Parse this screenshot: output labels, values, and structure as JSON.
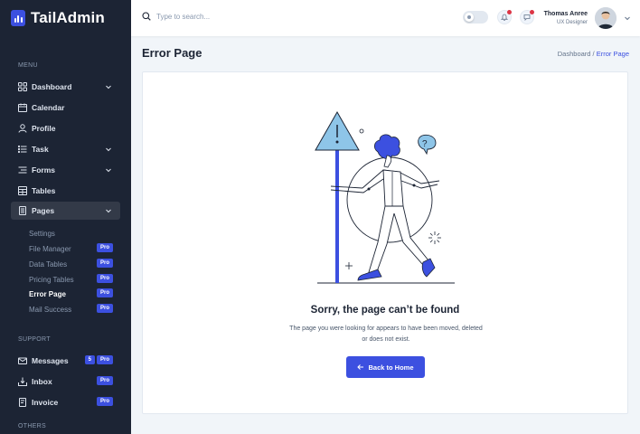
{
  "brand": {
    "name": "TailAdmin"
  },
  "sidebar": {
    "menu_title": "MENU",
    "items": [
      {
        "label": "Dashboard"
      },
      {
        "label": "Calendar"
      },
      {
        "label": "Profile"
      },
      {
        "label": "Task"
      },
      {
        "label": "Forms"
      },
      {
        "label": "Tables"
      },
      {
        "label": "Pages"
      }
    ],
    "pages_sub": [
      {
        "label": "Settings",
        "badge": ""
      },
      {
        "label": "File Manager",
        "badge": "Pro"
      },
      {
        "label": "Data Tables",
        "badge": "Pro"
      },
      {
        "label": "Pricing Tables",
        "badge": "Pro"
      },
      {
        "label": "Error Page",
        "badge": "Pro"
      },
      {
        "label": "Mail Success",
        "badge": "Pro"
      }
    ],
    "support_title": "SUPPORT",
    "support": [
      {
        "label": "Messages",
        "count": "5",
        "badge": "Pro"
      },
      {
        "label": "Inbox",
        "badge": "Pro"
      },
      {
        "label": "Invoice",
        "badge": "Pro"
      }
    ],
    "others_title": "OTHERS"
  },
  "header": {
    "search_placeholder": "Type to search...",
    "user_name": "Thomas Anree",
    "user_role": "UX Designer"
  },
  "page": {
    "title": "Error Page",
    "breadcrumb_parent": "Dashboard /",
    "breadcrumb_current": "Error Page"
  },
  "error": {
    "title": "Sorry, the page can’t be found",
    "message": "The page you were looking for appears to have been moved, deleted or does not exist.",
    "button_label": "Back to Home"
  },
  "colors": {
    "sidebar_bg": "#1c2434",
    "primary": "#3c50e0",
    "page_bg": "#f1f5f9"
  }
}
